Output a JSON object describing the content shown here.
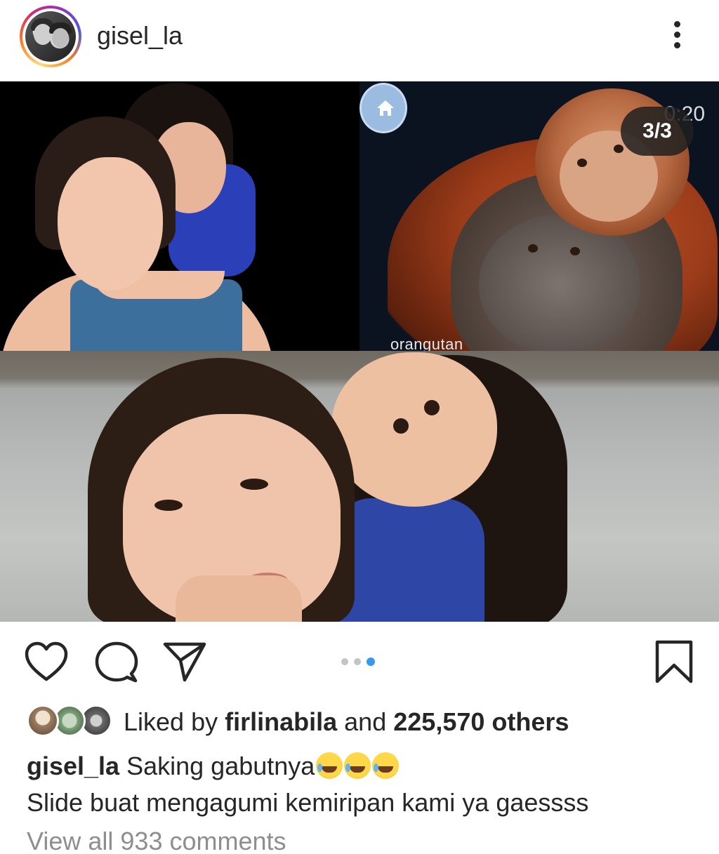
{
  "header": {
    "username": "gisel_la"
  },
  "media": {
    "counter": "3/3",
    "video_time_ghost": "0:20",
    "panel_label": "orangutan",
    "carousel": {
      "total": 3,
      "active_index": 3
    }
  },
  "likes": {
    "prefix": "Liked by",
    "first_liker": "firlinabila",
    "conjunction": "and",
    "others": "225,570 others"
  },
  "caption": {
    "username": "gisel_la",
    "line1": "Saking gabutnya",
    "emoji_count": 3,
    "line2": "Slide buat mengagumi kemiripan kami ya gaessss"
  },
  "comments": {
    "view_all": "View all 933 comments"
  },
  "colors": {
    "text": "#262626",
    "muted": "#8e8e8e",
    "accent_dot": "#3897f0"
  },
  "icons": [
    "more-icon",
    "like-icon",
    "comment-icon",
    "share-icon",
    "save-icon",
    "home-icon"
  ]
}
